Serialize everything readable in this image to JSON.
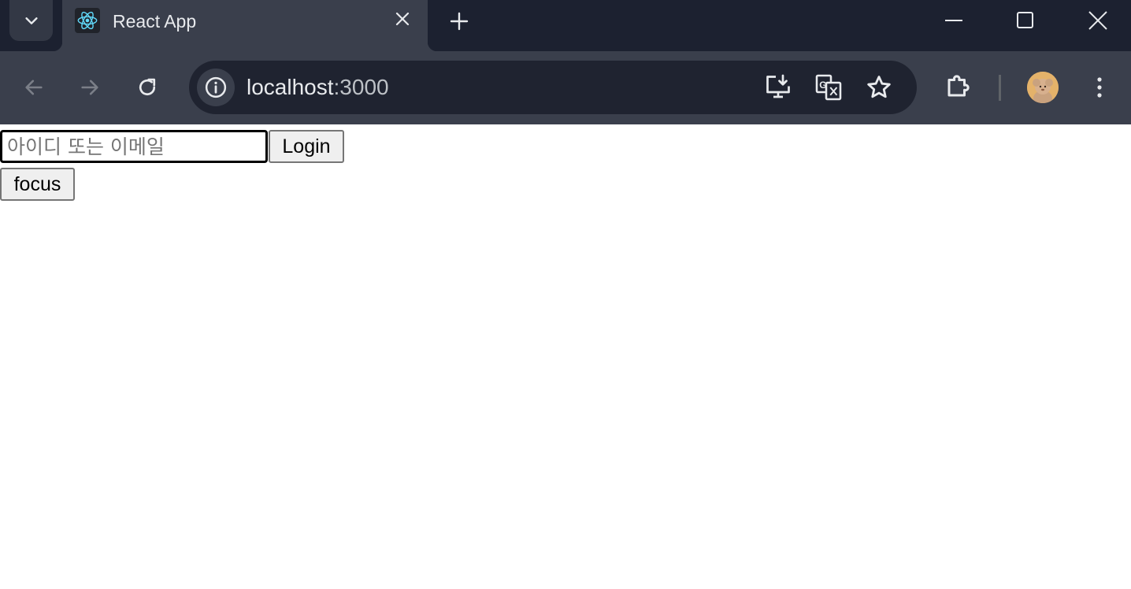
{
  "browser": {
    "tab": {
      "title": "React App",
      "favicon": "react-logo"
    },
    "address_bar": {
      "host": "localhost",
      "port": ":3000"
    },
    "icons": {
      "tab_search": "chevron-down-icon",
      "tab_close": "close-icon",
      "new_tab": "plus-icon",
      "minimize": "minimize-icon",
      "maximize": "maximize-icon",
      "close_window": "close-icon",
      "back": "arrow-left-icon",
      "forward": "arrow-right-icon",
      "reload": "reload-icon",
      "site_info": "info-icon",
      "install_app": "install-icon",
      "translate": "translate-icon",
      "bookmark": "star-icon",
      "extensions": "puzzle-icon",
      "menu": "kebab-menu-icon"
    },
    "colors": {
      "tabstrip": "#1c2130",
      "active_tab": "#3a3f4c",
      "omnibox": "#1f2330",
      "react_blue": "#61dafb"
    }
  },
  "page": {
    "id_input": {
      "placeholder": "아이디 또는 이메일",
      "value": ""
    },
    "login_label": "Login",
    "focus_label": "focus"
  }
}
